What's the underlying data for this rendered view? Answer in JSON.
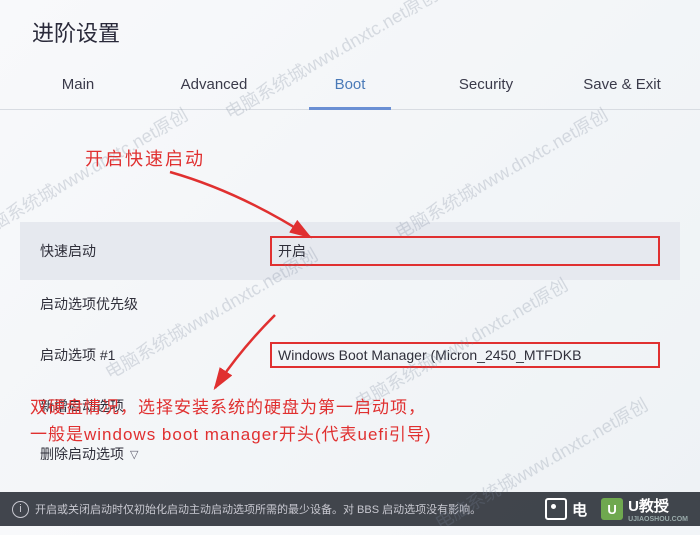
{
  "title": "进阶设置",
  "tabs": [
    {
      "label": "Main",
      "active": false
    },
    {
      "label": "Advanced",
      "active": false
    },
    {
      "label": "Boot",
      "active": true
    },
    {
      "label": "Security",
      "active": false
    },
    {
      "label": "Save & Exit",
      "active": false
    }
  ],
  "rows": {
    "fast_boot": {
      "label": "快速启动",
      "value": "开启"
    },
    "priority": {
      "label": "启动选项优先级"
    },
    "option1": {
      "label": "启动选项 #1",
      "value": "Windows Boot Manager (Micron_2450_MTFDKB"
    },
    "add": {
      "label": "新增启动选项"
    },
    "delete": {
      "label": "删除启动选项"
    }
  },
  "annotations": {
    "a1": "开启快速启动",
    "a2_line1": "双硬盘情况，选择安装系统的硬盘为第一启动项，",
    "a2_line2": "一般是windows boot manager开头(代表uefi引导)"
  },
  "footer": {
    "help": "开启或关闭启动时仅初始化启动主动启动选项所需的最少设备。对 BBS 启动选项没有影响。"
  },
  "logos": {
    "a": "电",
    "b_glyph": "U",
    "b_label": "U教授",
    "b_sub": "UJIAOSHOU.COM"
  },
  "watermark": "电脑系统城www.dnxtc.net原创"
}
